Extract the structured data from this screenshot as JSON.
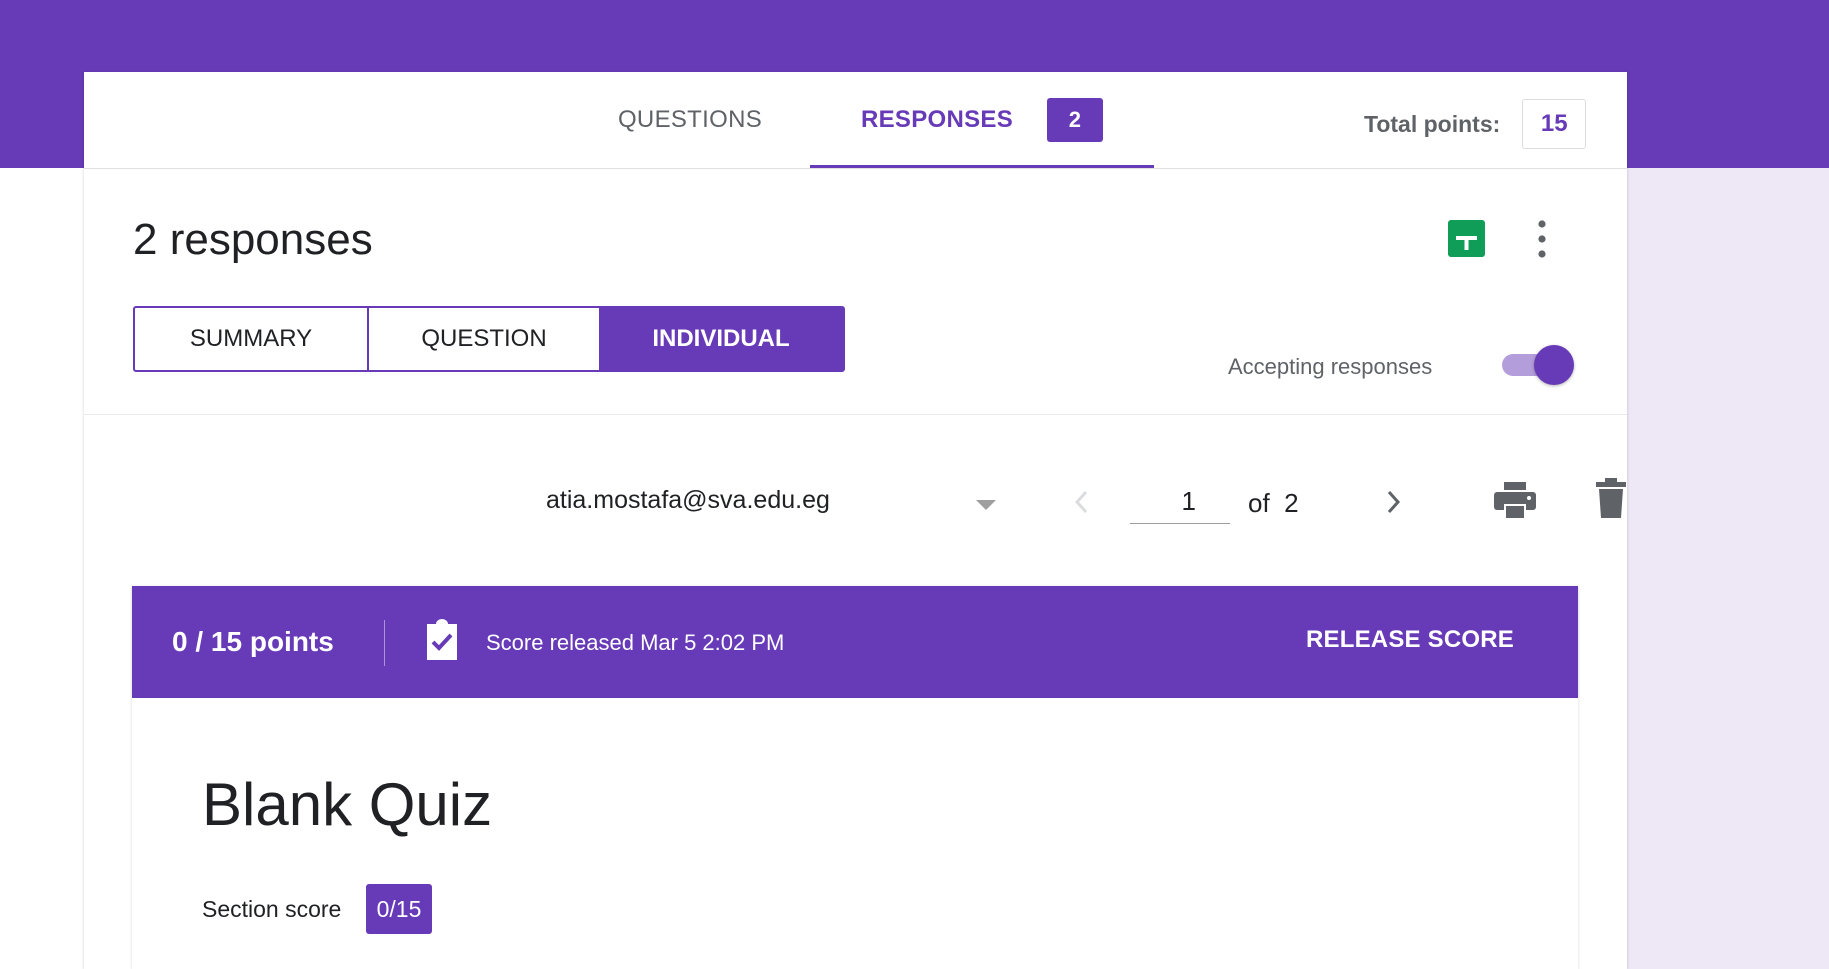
{
  "header": {
    "tabs": [
      {
        "label": "QUESTIONS"
      },
      {
        "label": "RESPONSES",
        "badge": "2",
        "active": true
      }
    ],
    "total_points_label": "Total points:",
    "total_points_value": "15"
  },
  "responses": {
    "title": "2 responses",
    "view_tabs": [
      "SUMMARY",
      "QUESTION",
      "INDIVIDUAL"
    ],
    "active_view": "INDIVIDUAL",
    "accepting_label": "Accepting responses",
    "accepting_on": true,
    "sheets_icon": "google-sheets-icon",
    "more_icon": "more-vert-icon"
  },
  "individual": {
    "respondent": "atia.mostafa@sva.edu.eg",
    "current_page": "1",
    "of_label": "of",
    "total_pages": "2"
  },
  "score": {
    "points": "0 / 15 points",
    "released_text": "Score released Mar 5 2:02 PM",
    "release_button": "RELEASE SCORE"
  },
  "form": {
    "title": "Blank Quiz",
    "section_score_label": "Section score",
    "section_score_value": "0/15"
  },
  "colors": {
    "accent": "#673ab7",
    "accent_light": "#b39ddb",
    "page_bg": "#ede7f6",
    "sheets_green": "#0f9d58"
  }
}
